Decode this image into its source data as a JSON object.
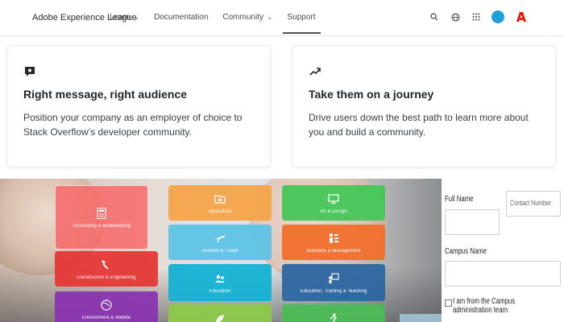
{
  "header": {
    "brand": "Adobe Experience League",
    "nav": [
      {
        "label": "Learn",
        "has_menu": true
      },
      {
        "label": "Documentation",
        "has_menu": false
      },
      {
        "label": "Community",
        "has_menu": true
      },
      {
        "label": "Support",
        "has_menu": false,
        "active": true
      }
    ],
    "icons": [
      "search-icon",
      "globe-icon",
      "apps-grid-icon",
      "avatar",
      "adobe-logo"
    ],
    "accent": "#1fa1d6",
    "brand_red": "#eb1000"
  },
  "cards": [
    {
      "icon": "speech-bubble-icon",
      "title": "Right message, right audience",
      "body": "Position your company as an employer of choice to Stack Overflow’s developer community."
    },
    {
      "icon": "trend-arrow-icon",
      "title": "Take them on a journey",
      "body": "Drive users down the best path to learn more about you and build a community."
    }
  ],
  "tiles": [
    {
      "label": "Accounting & Bookkeeping",
      "color": "#f86868"
    },
    {
      "label": "Construction & Engineering",
      "color": "#e53836"
    },
    {
      "label": "Environment & Wildlife",
      "color": "#8934b0"
    },
    {
      "label": "Agriculture",
      "color": "#f6a44a"
    },
    {
      "label": "Aviation & Travel",
      "color": "#5ec3e6"
    },
    {
      "label": "Education",
      "color": "#15b2d4"
    },
    {
      "label": "",
      "color": "#8cc949"
    },
    {
      "label": "Art & Design",
      "color": "#46c759"
    },
    {
      "label": "Business & Management",
      "color": "#f16f2d"
    },
    {
      "label": "Education, Training & Teaching",
      "color": "#2d66a1"
    },
    {
      "label": "",
      "color": "#4cbb56"
    }
  ],
  "form": {
    "full_name_label": "Full Name",
    "contact_placeholder": "Contact Number",
    "campus_label": "Campus Name",
    "admin_checkbox_label": "I am from the Campus administration team"
  }
}
